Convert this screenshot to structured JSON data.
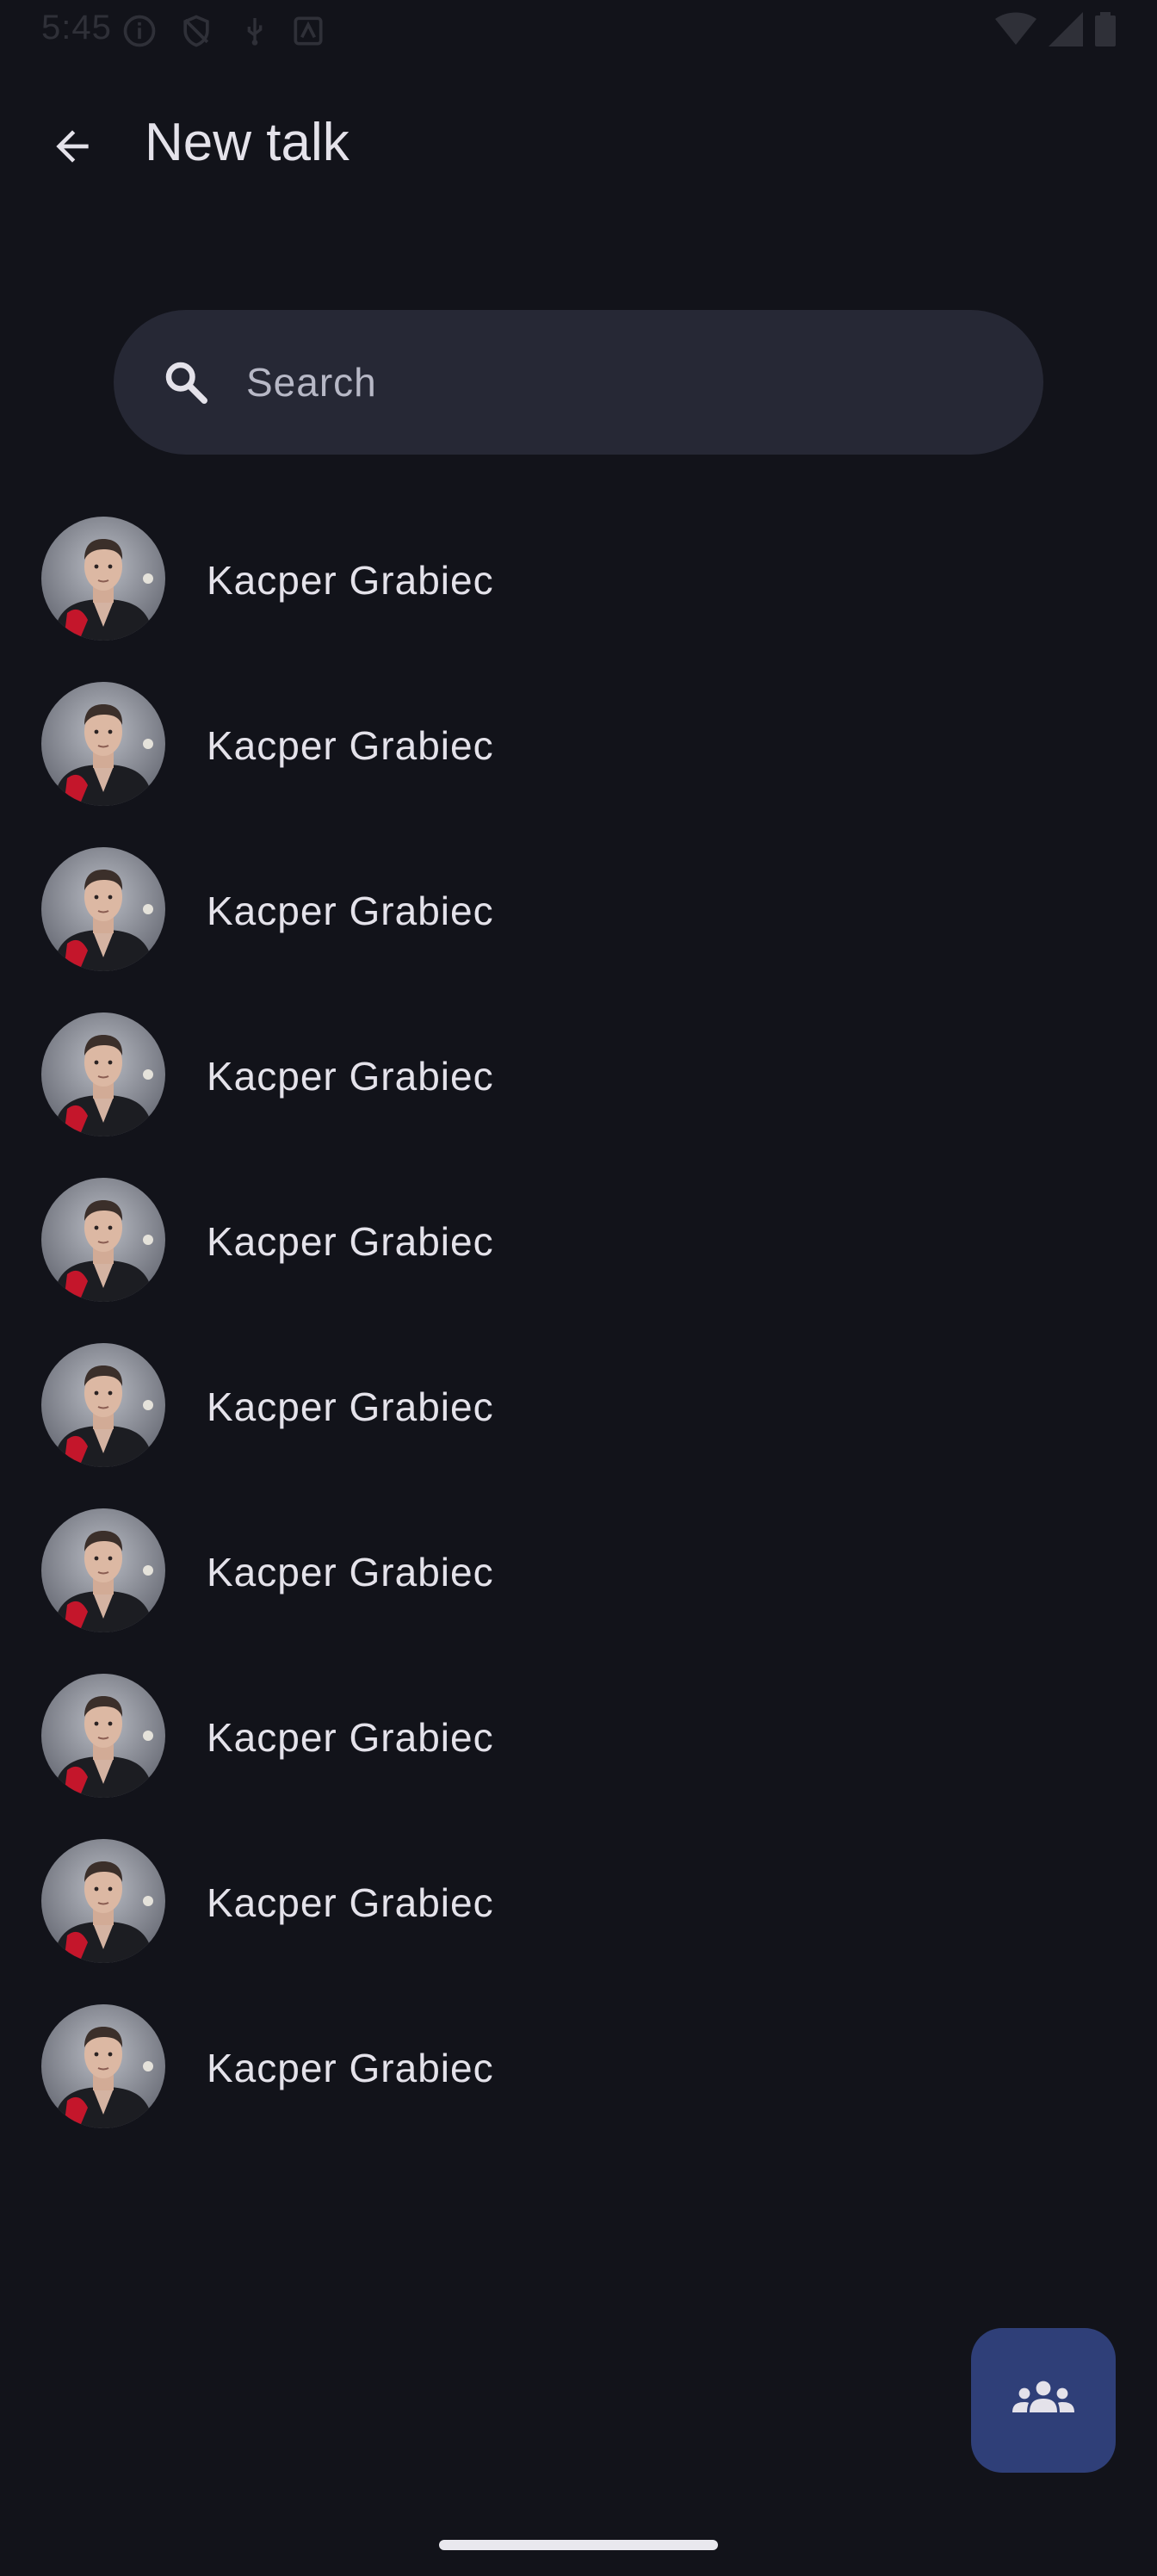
{
  "status_bar": {
    "time": "5:45"
  },
  "app_bar": {
    "title": "New talk",
    "back_icon": "arrow-back-icon"
  },
  "search": {
    "placeholder": "Search",
    "value": "",
    "icon": "search-icon"
  },
  "contacts": [
    {
      "name": "Kacper Grabiec"
    },
    {
      "name": "Kacper Grabiec"
    },
    {
      "name": "Kacper Grabiec"
    },
    {
      "name": "Kacper Grabiec"
    },
    {
      "name": "Kacper Grabiec"
    },
    {
      "name": "Kacper Grabiec"
    },
    {
      "name": "Kacper Grabiec"
    },
    {
      "name": "Kacper Grabiec"
    },
    {
      "name": "Kacper Grabiec"
    },
    {
      "name": "Kacper Grabiec"
    }
  ],
  "fab": {
    "icon": "group-icon"
  },
  "colors": {
    "background": "#12131a",
    "search_bg": "#262835",
    "fab_bg": "#2f3f78",
    "text": "#e4e2ea"
  }
}
